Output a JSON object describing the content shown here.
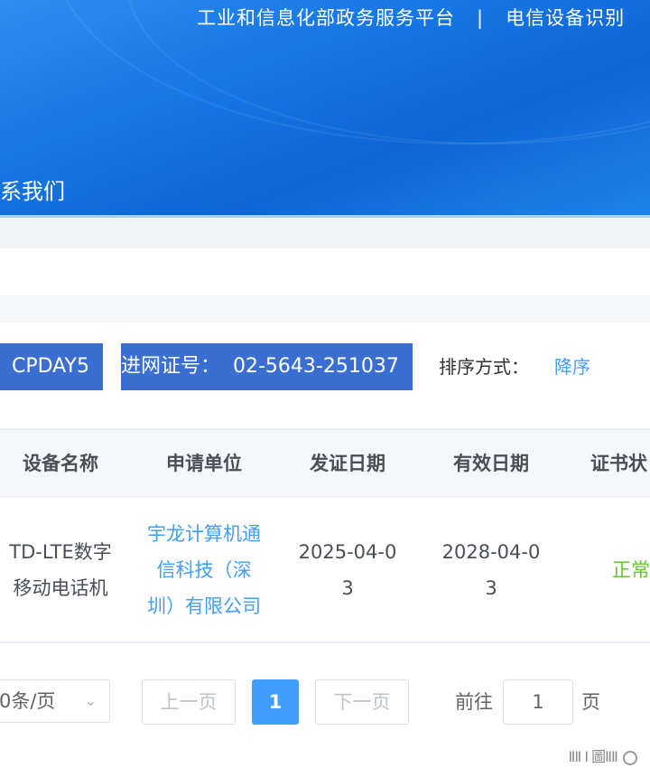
{
  "header": {
    "platform_link": "工业和信息化部政务服务平台",
    "separator": "|",
    "system_link": "电信设备识别",
    "nav_contact": "联系我们",
    "colors": {
      "banner": "#1677e6",
      "banner_light": "#2f8ef0"
    }
  },
  "filters": {
    "model_chip": "CPDAY5",
    "cert_chip": "进网证号：  02-5643-251037",
    "sort_label": "排序方式：",
    "sort_value": "降序"
  },
  "table": {
    "columns": [
      "设备名称",
      "申请单位",
      "发证日期",
      "有效日期",
      "证书状"
    ],
    "rows": [
      {
        "device_name": "TD-LTE数字移动电话机",
        "applicant": "宇龙计算机通信科技（深圳）有限公司",
        "issue_date": "2025-04-03",
        "valid_date": "2028-04-03",
        "status": "正常"
      }
    ]
  },
  "pagination": {
    "page_size": "0条/页",
    "prev": "上一页",
    "current_page": "1",
    "next": "下一页",
    "goto_label": "前往",
    "goto_value": "1",
    "goto_suffix": "页"
  },
  "watermark": {
    "text": "ⅡⅡ Ⅰ 圖ⅡⅡ",
    "icon": "circle-icon"
  },
  "colors": {
    "chip": "#3a6fd1",
    "link": "#409eff",
    "status_ok": "#67c23a"
  }
}
